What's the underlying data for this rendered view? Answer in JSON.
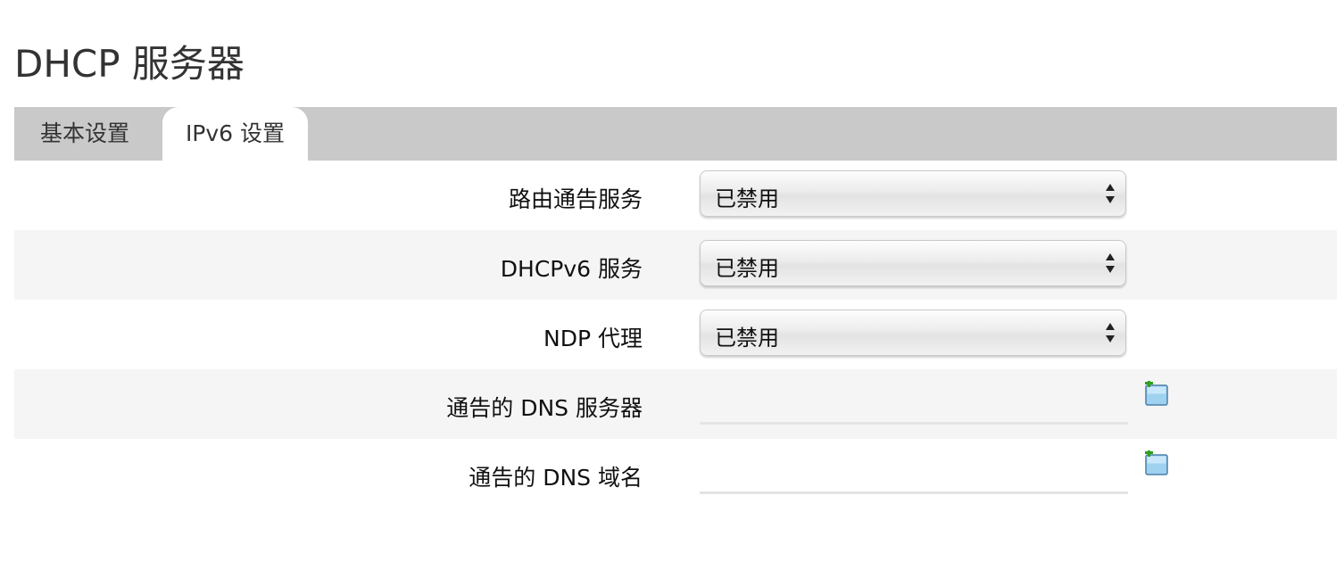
{
  "page": {
    "title": "DHCP 服务器"
  },
  "tabs": [
    {
      "label": "基本设置",
      "active": false
    },
    {
      "label": "IPv6 设置",
      "active": true
    }
  ],
  "fields": {
    "ra_service": {
      "label": "路由通告服务",
      "value": "已禁用"
    },
    "dhcpv6_service": {
      "label": "DHCPv6 服务",
      "value": "已禁用"
    },
    "ndp_proxy": {
      "label": "NDP 代理",
      "value": "已禁用"
    },
    "dns_servers": {
      "label": "通告的 DNS 服务器",
      "value": ""
    },
    "dns_domains": {
      "label": "通告的 DNS 域名",
      "value": ""
    }
  },
  "icons": {
    "select_arrows": "up-down-arrows-icon",
    "add_entry": "add-entry-icon"
  },
  "colors": {
    "tabbar_bg": "#c9c9c9",
    "row_alt_bg": "#f5f5f5",
    "add_icon_green": "#2fa11f",
    "add_icon_blue": "#9fd1f0"
  }
}
